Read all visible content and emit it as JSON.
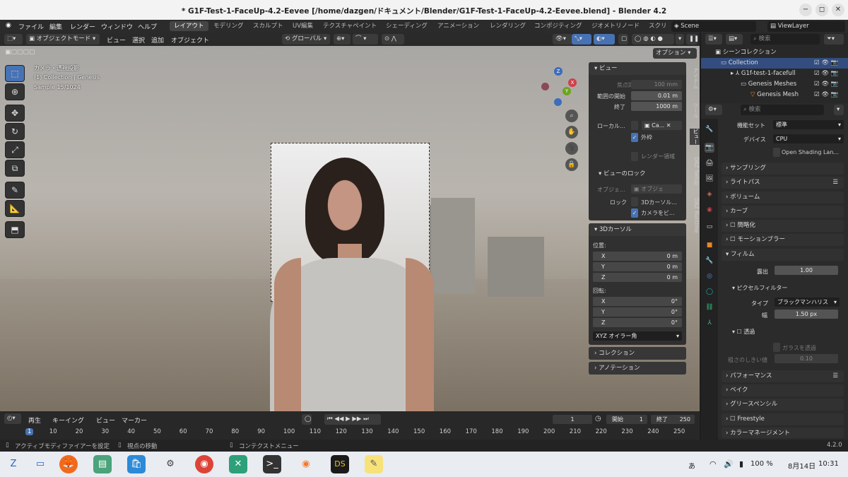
{
  "window": {
    "title": "* G1F-Test-1-FaceUp-4.2-Eevee [/home/dazgen/ドキュメント/Blender/G1F-Test-1-FaceUp-4.2-Eevee.blend] - Blender 4.2"
  },
  "menu": {
    "items": [
      "ファイル",
      "編集",
      "レンダー",
      "ウィンドウ",
      "ヘルプ"
    ],
    "workspaces": [
      "レイアウト",
      "モデリング",
      "スカルプト",
      "UV編集",
      "テクスチャペイント",
      "シェーディング",
      "アニメーション",
      "レンダリング",
      "コンポジティング",
      "ジオメトリノード",
      "スクリ"
    ],
    "scene": "Scene",
    "view_layer": "ViewLayer"
  },
  "viewport_header": {
    "mode": "オブジェクトモード",
    "menus": [
      "ビュー",
      "選択",
      "追加",
      "オブジェクト"
    ],
    "transform": "グローバル",
    "options": "オプション"
  },
  "viewport": {
    "camera_line": "カメラ・透視投影",
    "collection_line": "(1) Collection | Genesis",
    "sample_line": "Sample 15/1024",
    "gizmo": {
      "x": "X",
      "y": "Y",
      "z": "Z"
    }
  },
  "npanel": {
    "view_header": "ビュー",
    "focal_label": "焦点距離",
    "focal_value": "100 mm",
    "clip_start_label": "範囲の開始",
    "clip_start_value": "0.01 m",
    "clip_end_label": "終了",
    "clip_end_value": "1000 m",
    "local_label": "ローカル...",
    "local_value": "Ca...",
    "outline_label": "外枠",
    "render_region_label": "レンダー領域",
    "view_lock_header": "ビューのロック",
    "object_label": "オブジェ...",
    "object_value": "オブジェ",
    "lock_label": "ロック",
    "lock_cursor": "3Dカーソル...",
    "lock_camera": "カメラをビ...",
    "cursor_header": "3Dカーソル",
    "location_label": "位置:",
    "rotation_label": "回転:",
    "loc": [
      {
        "axis": "X",
        "value": "0 m"
      },
      {
        "axis": "Y",
        "value": "0 m"
      },
      {
        "axis": "Z",
        "value": "0 m"
      }
    ],
    "rot": [
      {
        "axis": "X",
        "value": "0°"
      },
      {
        "axis": "Y",
        "value": "0°"
      },
      {
        "axis": "Z",
        "value": "0°"
      }
    ],
    "rot_mode": "XYZ オイラー角",
    "collection_header": "コレクション",
    "annotation_header": "アノテーション",
    "tabs": [
      "アイテム",
      "ツール",
      "ビュー",
      "DAZ Setup",
      "DAZ Runtime"
    ]
  },
  "timeline": {
    "playback": "再生",
    "keying": "キーイング",
    "view": "ビュー",
    "marker": "マーカー",
    "current_frame": "1",
    "start_label": "開始",
    "start": "1",
    "end_label": "終了",
    "end": "250",
    "ticks": [
      "1",
      "10",
      "20",
      "30",
      "40",
      "50",
      "60",
      "70",
      "80",
      "90",
      "100",
      "110",
      "120",
      "130",
      "140",
      "150",
      "160",
      "170",
      "180",
      "190",
      "200",
      "210",
      "220",
      "230",
      "240",
      "250"
    ]
  },
  "status": {
    "left": "アクティブモディファイアーを設定",
    "mid": "視点の移動",
    "ctx": "コンテクストメニュー",
    "version": "4.2.0"
  },
  "outliner": {
    "search_placeholder": "検索",
    "rows": [
      "シーンコレクション",
      "Collection",
      "G1f-test-1-facefull",
      "Genesis Meshes",
      "Genesis Mesh"
    ]
  },
  "properties": {
    "search_placeholder": "検索",
    "feature_label": "機能セット",
    "feature_value": "標準",
    "device_label": "デバイス",
    "device_value": "CPU",
    "osl": "Open Shading Lan...",
    "sections": [
      "サンプリング",
      "ライトパス",
      "ボリューム",
      "カーブ",
      "簡略化",
      "モーションブラー",
      "フィルム"
    ],
    "exposure_label": "露出",
    "exposure_value": "1.00",
    "pixel_filter": "ピクセルフィルター",
    "type_label": "タイプ",
    "type_value": "ブラックマンハリス",
    "width_label": "幅",
    "width_value": "1.50 px",
    "transparent": "透過",
    "glass": "ガラスを透過",
    "roughness_label": "粗さのしきい値",
    "roughness_value": "0.10",
    "sections2": [
      "パフォーマンス",
      "ベイク",
      "グリースペンシル",
      "Freestyle",
      "カラーマネージメント"
    ]
  },
  "taskbar": {
    "ime": "あ",
    "battery": "100 %",
    "date": "8月14日",
    "time": "10:31"
  },
  "colors": {
    "accent": "#4772b3",
    "header": "#2b2b2b",
    "panel": "#303030"
  }
}
